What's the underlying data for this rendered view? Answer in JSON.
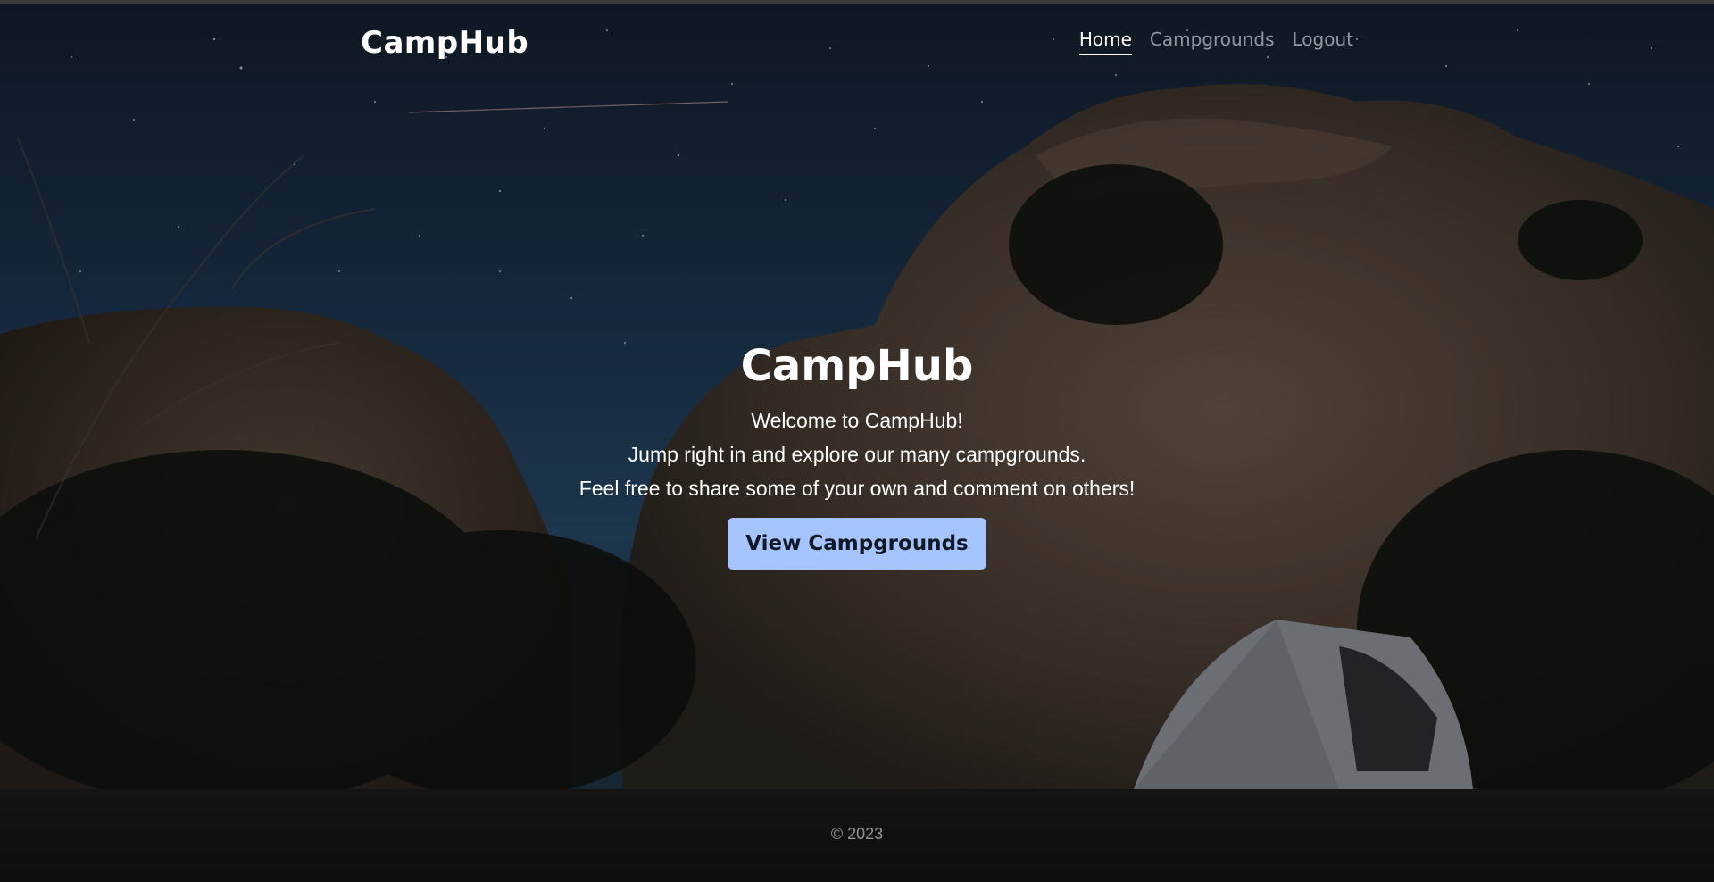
{
  "header": {
    "brand": "CampHub",
    "nav": [
      {
        "label": "Home",
        "active": true
      },
      {
        "label": "Campgrounds",
        "active": false
      },
      {
        "label": "Logout",
        "active": false
      }
    ]
  },
  "hero": {
    "title": "CampHub",
    "lines": [
      "Welcome to CampHub!",
      "Jump right in and explore our many campgrounds.",
      "Feel free to share some of your own and comment on others!"
    ],
    "button_label": "View Campgrounds"
  },
  "footer": {
    "copyright": "© 2023"
  },
  "colors": {
    "button_bg": "#a4c4fb",
    "text": "#ffffff",
    "nav_inactive": "rgba(255,255,255,0.55)"
  }
}
